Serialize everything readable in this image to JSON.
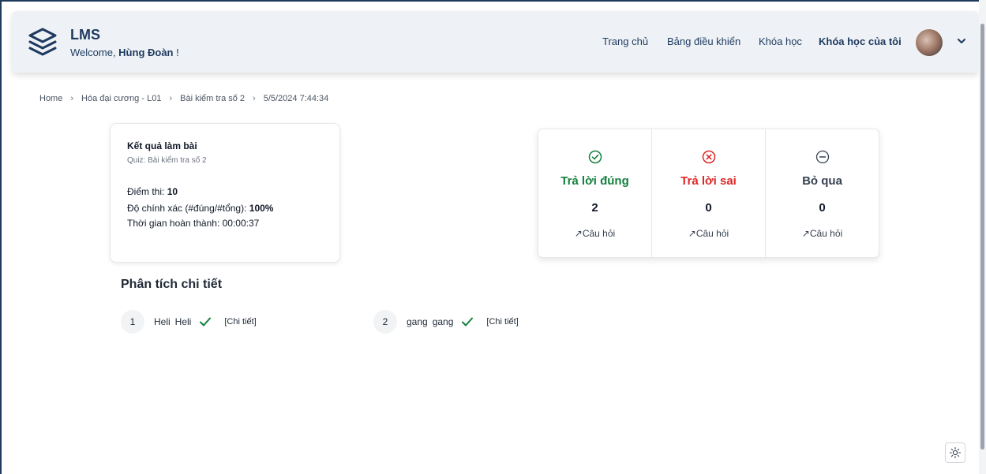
{
  "header": {
    "brand": "LMS",
    "welcome_prefix": "Welcome, ",
    "user_name": "Hùng Đoàn",
    "welcome_suffix": " !",
    "nav": [
      {
        "label": "Trang chủ"
      },
      {
        "label": "Bảng điều khiển"
      },
      {
        "label": "Khóa học"
      },
      {
        "label": "Khóa học của tôi"
      }
    ]
  },
  "breadcrumb": [
    "Home",
    "Hóa đại cương - L01",
    "Bài kiểm tra số 2",
    "5/5/2024 7:44:34"
  ],
  "breadcrumb_sep": "›",
  "result": {
    "title": "Kết quả làm bài",
    "subtitle": "Quiz: Bài kiểm tra số 2",
    "score_label": "Điểm thi: ",
    "score_value": "10",
    "accuracy_label": "Độ chính xác (#đúng/#tổng): ",
    "accuracy_value": "100%",
    "time_label": "Thời gian hoàn thành: ",
    "time_value": "00:00:37"
  },
  "stats": [
    {
      "label": "Trả lời đúng",
      "value": "2",
      "link": "↗Câu hỏi",
      "color": "#15803d",
      "icon": "check-circle-icon"
    },
    {
      "label": "Trả lời sai",
      "value": "0",
      "link": "↗Câu hỏi",
      "color": "#dc2626",
      "icon": "x-circle-icon"
    },
    {
      "label": "Bỏ qua",
      "value": "0",
      "link": "↗Câu hỏi",
      "color": "#374151",
      "icon": "minus-circle-icon"
    }
  ],
  "analysis": {
    "title": "Phân tích chi tiết",
    "items": [
      {
        "number": "1",
        "user_answer": "Heli",
        "correct_answer": "Heli",
        "detail": "[Chi tiết]"
      },
      {
        "number": "2",
        "user_answer": "gang",
        "correct_answer": "gang",
        "detail": "[Chi tiết]"
      }
    ]
  },
  "colors": {
    "brand": "#1e3a5f",
    "correct": "#15803d",
    "wrong": "#dc2626"
  }
}
